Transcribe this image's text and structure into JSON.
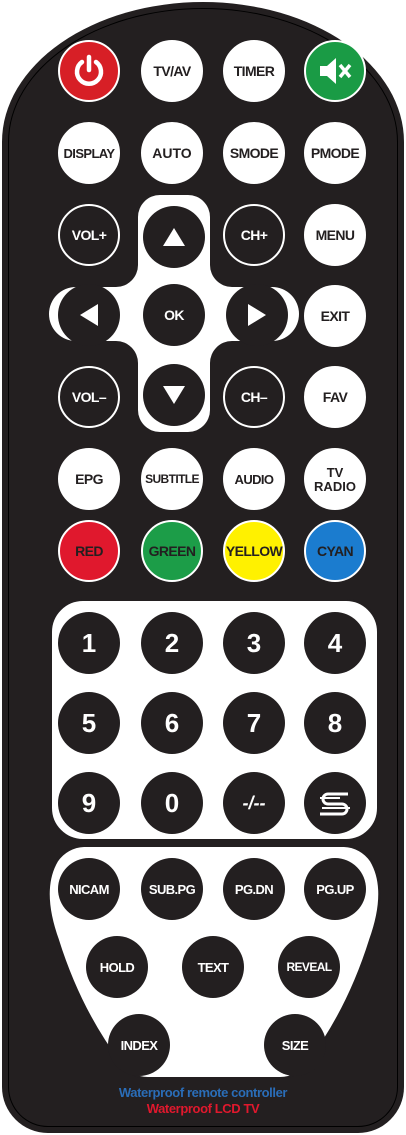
{
  "row1": {
    "tv_av": "TV/AV",
    "timer": "TIMER"
  },
  "row2": {
    "display": "DISPLAY",
    "auto": "AUTO",
    "smode": "SMODE",
    "pmode": "PMODE"
  },
  "nav": {
    "vol_up": "VOL+",
    "ch_up": "CH+",
    "menu": "MENU",
    "ok": "OK",
    "exit": "EXIT",
    "vol_down": "VOL–",
    "ch_down": "CH–",
    "fav": "FAV"
  },
  "row_media": {
    "epg": "EPG",
    "subtitle": "SUBTITLE",
    "audio": "AUDIO",
    "tv_radio_line1": "TV",
    "tv_radio_line2": "RADIO"
  },
  "colors": {
    "red": "RED",
    "green": "GREEN",
    "yellow": "YELLOW",
    "cyan": "CYAN"
  },
  "numpad": {
    "k1": "1",
    "k2": "2",
    "k3": "3",
    "k4": "4",
    "k5": "5",
    "k6": "6",
    "k7": "7",
    "k8": "8",
    "k9": "9",
    "k0": "0",
    "dash": "-/--"
  },
  "teletext": {
    "nicam": "NICAM",
    "subpg": "SUB.PG",
    "pgdn": "PG.DN",
    "pgup": "PG.UP",
    "hold": "HOLD",
    "text": "TEXT",
    "reveal": "REVEAL",
    "index": "INDEX",
    "size": "SIZE"
  },
  "footer": {
    "line1": "Waterproof remote controller",
    "line2": "Waterproof LCD TV"
  },
  "palette": {
    "body": "#231f20",
    "power": "#d71f26",
    "mute": "#1a9b45",
    "red": "#e0182d",
    "green": "#1c9d48",
    "yellow": "#fff100",
    "cyan": "#1b7ccf",
    "footer_blue": "#2a6db8",
    "footer_red": "#e0182d"
  },
  "icons": [
    "power-icon",
    "mute-icon",
    "arrow-up-icon",
    "arrow-left-icon",
    "arrow-right-icon",
    "arrow-down-icon",
    "swap-icon"
  ]
}
